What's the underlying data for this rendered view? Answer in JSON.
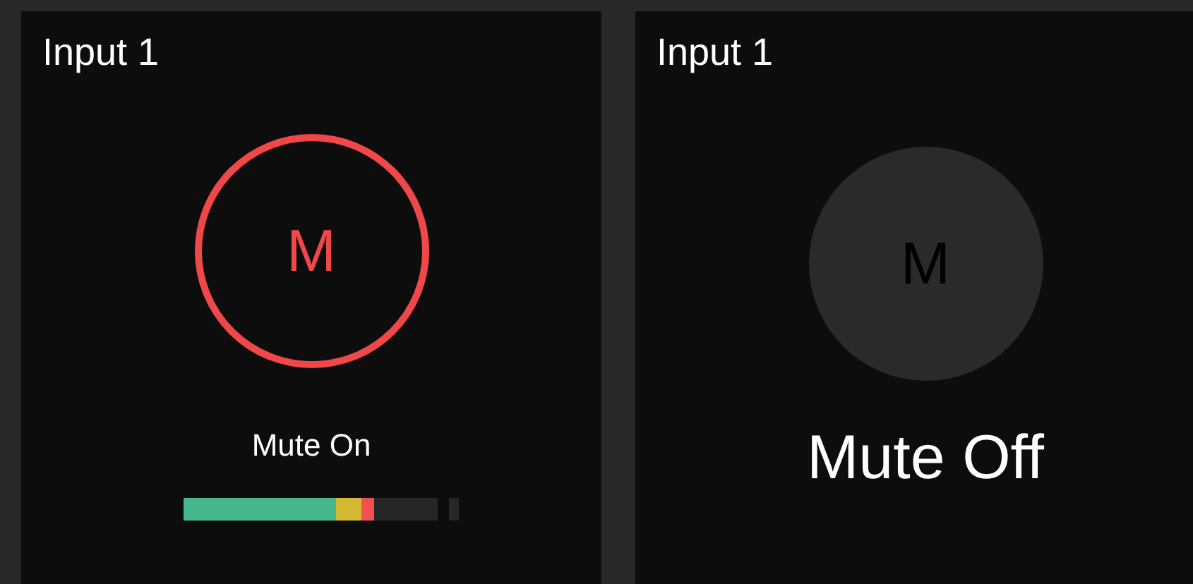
{
  "channels": [
    {
      "title": "Input 1",
      "button_label": "M",
      "muted": true,
      "status": "Mute On",
      "meter": {
        "level": 0.75,
        "clip": false
      }
    },
    {
      "title": "Input 1",
      "button_label": "M",
      "muted": false,
      "status": "Mute Off"
    }
  ]
}
